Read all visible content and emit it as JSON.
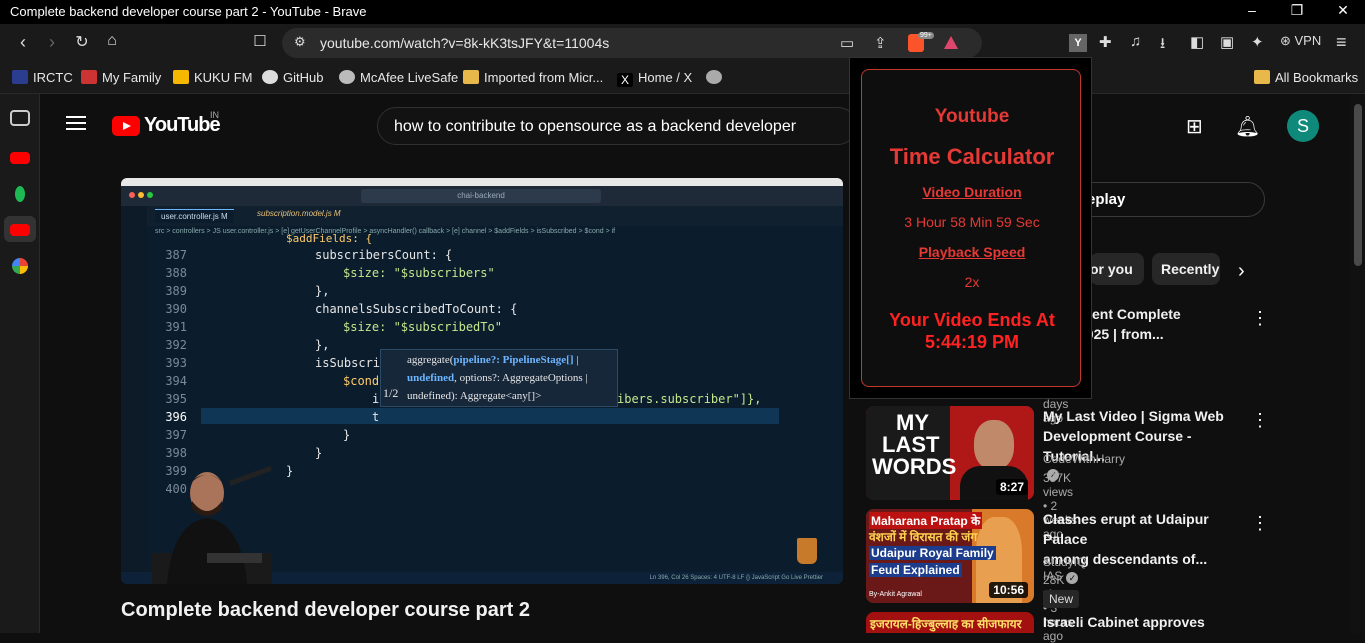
{
  "browser": {
    "window_title": "Complete backend developer course part 2 - YouTube - Brave",
    "url": "youtube.com/watch?v=8k-kK3tsJFY&t=11004s",
    "shield_badge": "99+",
    "vpn_label": "VPN",
    "bookmarks": [
      {
        "label": "IRCTC",
        "icon": "irctc-icon"
      },
      {
        "label": "My Family",
        "icon": "family-icon"
      },
      {
        "label": "KUKU FM",
        "icon": "kukufm-icon"
      },
      {
        "label": "GitHub",
        "icon": "github-icon"
      },
      {
        "label": "McAfee LiveSafe",
        "icon": "mcafee-icon"
      },
      {
        "label": "Imported from Micr...",
        "icon": "folder-icon"
      },
      {
        "label": "Home / X",
        "icon": "x-icon"
      }
    ],
    "all_bookmarks": "All Bookmarks"
  },
  "youtube": {
    "logo_text": "YouTube",
    "region": "IN",
    "search_query": "how to contribute to opensource as a backend developer",
    "avatar_letter": "S",
    "video_title": "Complete backend developer course part 2",
    "replay_label": "eplay",
    "chips": [
      "or you",
      "Recently"
    ]
  },
  "editor": {
    "window_title": "chai-backend",
    "tab1": "user.controller.js M",
    "tab2": "subscription.model.js M",
    "breadcrumb": "src > controllers > JS user.controller.js > [e] getUserChannelProfile > asyncHandler() callback > [e] channel > $addFields > isSubscribed > $cond > if",
    "lines": [
      {
        "n": "387",
        "code": "subscribersCount: {"
      },
      {
        "n": "388",
        "code": "$size: \"$subscribers\""
      },
      {
        "n": "389",
        "code": "},"
      },
      {
        "n": "390",
        "code": "channelsSubscribedToCount: {"
      },
      {
        "n": "391",
        "code": "$size: \"$subscribedTo\""
      },
      {
        "n": "392",
        "code": "},"
      },
      {
        "n": "393",
        "code": "isSubscri"
      },
      {
        "n": "394",
        "code": "$cond"
      },
      {
        "n": "395",
        "code": "i"
      },
      {
        "n": "396",
        "code": "t"
      },
      {
        "n": "397",
        "code": "}"
      },
      {
        "n": "398",
        "code": "}"
      },
      {
        "n": "399",
        "code": "}"
      },
      {
        "n": "400",
        "code": ""
      }
    ],
    "top_partial": "$addFields: {",
    "line395_tail": "ibers.subscriber\"]},",
    "popup_line1a": "aggregate(",
    "popup_line1b": "pipeline?: PipelineStage[]",
    "popup_line1c": " |",
    "popup_line2a": "undefined",
    "popup_line2b": ", options?: AggregateOptions |",
    "popup_line3": "undefined): Aggregate<any[]>",
    "popup_counter": "1/2",
    "status": "Ln 396, Col 26   Spaces: 4   UTF-8   LF   {} JavaScript   Go Live   Prettier"
  },
  "extension": {
    "title1": "Youtube",
    "title2": "Time Calculator",
    "duration_label": "Video Duration",
    "duration_value": "3 Hour 58 Min 59 Sec",
    "speed_label": "Playback Speed",
    "speed_value": "2x",
    "ends_label": "Your Video Ends At",
    "ends_value": "5:44:19 PM"
  },
  "recommendations": [
    {
      "title_l1": "velopment Complete",
      "title_l2": "p for 2025 | from...",
      "channel": "lege",
      "meta": "ws • 9 days ago"
    },
    {
      "title_l1": "My Last Video | Sigma Web",
      "title_l2": "Development Course - Tutorial...",
      "channel": "CodeWithHarry",
      "meta": "357K views • 2 weeks ago",
      "duration": "8:27",
      "thumb_text1": "MY",
      "thumb_text2": "LAST",
      "thumb_text3": "WORDS"
    },
    {
      "title_l1": "Clashes erupt at Udaipur Palace",
      "title_l2": "among descendants of...",
      "channel": "StudyIQ IAS",
      "meta": "28K views • 3 hours ago",
      "duration": "10:56",
      "badge": "New",
      "thumb_text1": "Maharana Pratap के",
      "thumb_text2": "वंशजों में विरासत की जंग",
      "thumb_text3": "Udaipur Royal Family",
      "thumb_text4": "Feud Explained",
      "thumb_text5": "By-Ankit Agrawal"
    },
    {
      "title_l1": "Israeli Cabinet approves",
      "thumb_text1": "इजरायल-हिज्बुल्लाह का सीजफायर"
    }
  ]
}
